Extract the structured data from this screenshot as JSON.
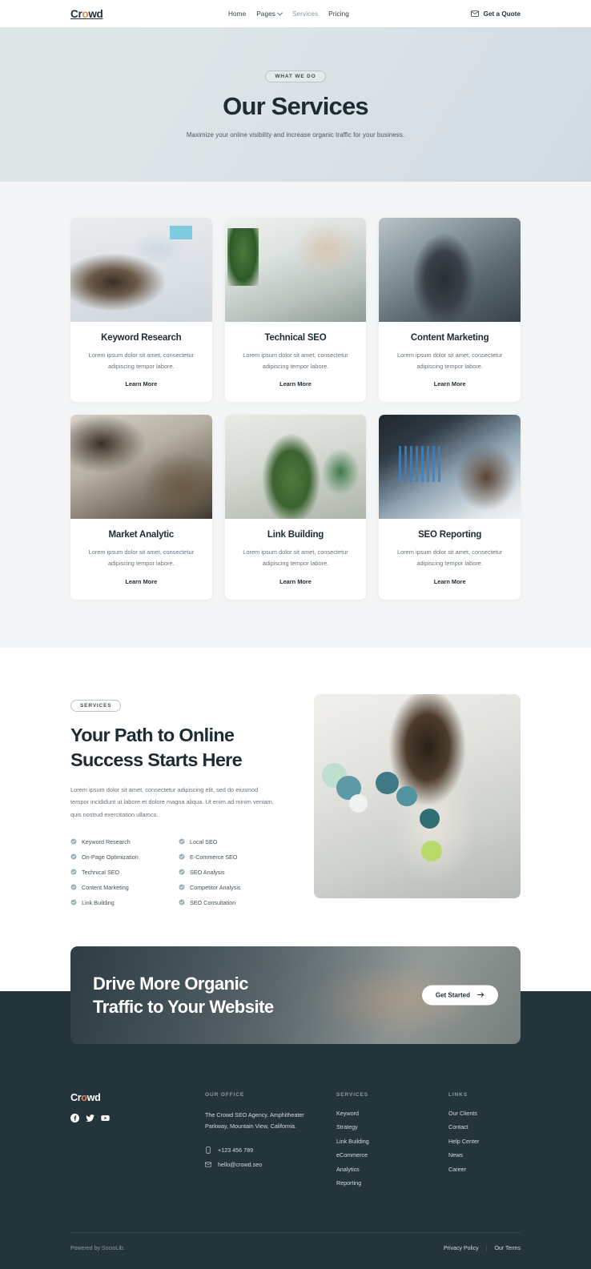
{
  "nav": {
    "logo": "Cr",
    "logo_dot": "o",
    "logo_end": "wd",
    "links": [
      {
        "label": "Home",
        "active": false,
        "caret": false
      },
      {
        "label": "Pages",
        "active": false,
        "caret": true
      },
      {
        "label": "Services",
        "active": true,
        "caret": false
      },
      {
        "label": "Pricing",
        "active": false,
        "caret": false
      }
    ],
    "cta_label": "Get a Quote",
    "cta_icon": "mail-icon"
  },
  "hero": {
    "eyebrow": "WHAT WE DO",
    "title": "Our Services",
    "subtitle": "Maximize your online visibility and increase organic traffic for your business."
  },
  "services": {
    "cards": [
      {
        "title": "Keyword Research",
        "desc": "Lorem ipsum dolor sit amet, consectetur adipiscing tempor labore.",
        "link": "Learn More"
      },
      {
        "title": "Technical SEO",
        "desc": "Lorem ipsum dolor sit amet, consectetur adipiscing tempor labore.",
        "link": "Learn More"
      },
      {
        "title": "Content Marketing",
        "desc": "Lorem ipsum dolor sit amet, consectetur adipiscing tempor labore.",
        "link": "Learn More"
      },
      {
        "title": "Market Analytic",
        "desc": "Lorem ipsum dolor sit amet, consectetur adipiscing tempor labore.",
        "link": "Learn More"
      },
      {
        "title": "Link Building",
        "desc": "Lorem ipsum dolor sit amet, consectetur adipiscing tempor labore.",
        "link": "Learn More"
      },
      {
        "title": "SEO Reporting",
        "desc": "Lorem ipsum dolor sit amet, consectetur adipiscing tempor labore.",
        "link": "Learn More"
      }
    ]
  },
  "path": {
    "eyebrow": "SERVICES",
    "title_line1": "Your Path to Online",
    "title_line2": "Success Starts Here",
    "lead": "Lorem ipsum dolor sit amet, consectetur adipiscing elit, sed do eiusmod tempor incididunt ut labore et dolore magna aliqua. Ut enim ad minim veniam, quis nostrud exercitation ullamco.",
    "features_left": [
      "Keyword Research",
      "On-Page Optimization",
      "Technical SEO",
      "Content Marketing",
      "Link Building"
    ],
    "features_right": [
      "Local SEO",
      "E-Commerce SEO",
      "SEO Analysis",
      "Competitor Analysis",
      "SEO Consultation"
    ]
  },
  "cta": {
    "title_line1": "Drive More Organic",
    "title_line2": "Traffic to Your Website",
    "button_label": "Get Started",
    "button_icon": "arrow-right-icon"
  },
  "footer": {
    "logo": "Cr",
    "logo_dot": "o",
    "logo_end": "wd",
    "socials": [
      "facebook-icon",
      "twitter-icon",
      "youtube-icon"
    ],
    "office": {
      "heading": "OUR OFFICE",
      "address": "The Crowd SEO Agency. Amphitheater Parkway, Mountain View, California.",
      "phone": "+123 456 789",
      "email": "hello@crowd.seo"
    },
    "services": {
      "heading": "SERVICES",
      "items": [
        "Keyword",
        "Strategy",
        "Link Building",
        "eCommerce",
        "Analytics",
        "Reporting"
      ]
    },
    "links": {
      "heading": "LINKS",
      "items": [
        "Our Clients",
        "Contact",
        "Help Center",
        "News",
        "Career"
      ]
    },
    "powered_prefix": "Powered by ",
    "powered_brand": "SocioLib.",
    "legal": [
      "Privacy Policy",
      "Our Terms"
    ],
    "legal_separator": "|"
  },
  "colors": {
    "accent": "#e8845a",
    "dark": "#1d2b33",
    "footer_bg": "#24343b",
    "muted": "#66737b",
    "check": "#9bb0b5"
  }
}
